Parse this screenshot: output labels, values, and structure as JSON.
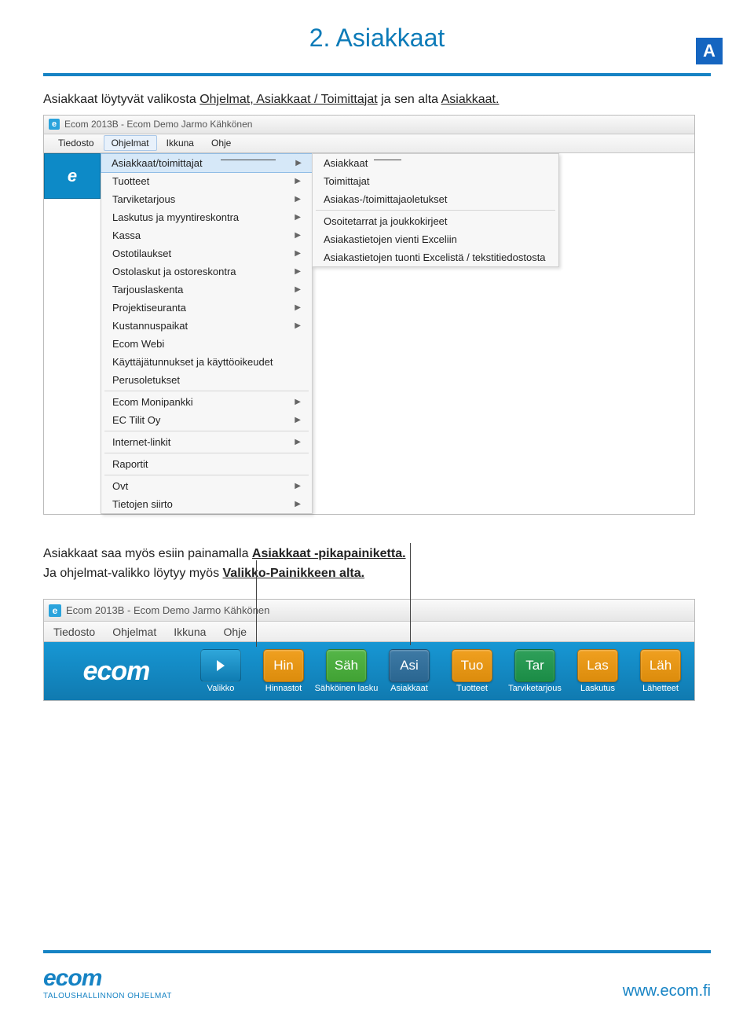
{
  "badge": "A",
  "heading": "2. Asiakkaat",
  "intro_parts": {
    "p1": "Asiakkaat löytyvät valikosta ",
    "u1": "Ohjelmat, Asiakkaat / Toimittajat",
    "p2": " ja sen alta ",
    "u2": "Asiakkaat.",
    "p3": ""
  },
  "shot1": {
    "title": "Ecom 2013B - Ecom Demo Jarmo Kähkönen",
    "menubar": [
      "Tiedosto",
      "Ohjelmat",
      "Ikkuna",
      "Ohje"
    ],
    "ecom_label": "e",
    "col1": [
      {
        "label": "Asiakkaat/toimittajat",
        "arrow": true,
        "hover": true
      },
      {
        "label": "Tuotteet",
        "arrow": true
      },
      {
        "label": "Tarviketarjous",
        "arrow": true
      },
      {
        "label": "Laskutus ja myyntireskontra",
        "arrow": true
      },
      {
        "label": "Kassa",
        "arrow": true
      },
      {
        "label": "Ostotilaukset",
        "arrow": true
      },
      {
        "label": "Ostolaskut ja ostoreskontra",
        "arrow": true
      },
      {
        "label": "Tarjouslaskenta",
        "arrow": true
      },
      {
        "label": "Projektiseuranta",
        "arrow": true
      },
      {
        "label": "Kustannuspaikat",
        "arrow": true
      },
      {
        "label": "Ecom Webi"
      },
      {
        "label": "Käyttäjätunnukset ja käyttöoikeudet"
      },
      {
        "label": "Perusoletukset"
      },
      {
        "sep": true
      },
      {
        "label": "Ecom Monipankki",
        "arrow": true
      },
      {
        "label": "EC Tilit Oy",
        "arrow": true
      },
      {
        "sep": true
      },
      {
        "label": "Internet-linkit",
        "arrow": true
      },
      {
        "sep": true
      },
      {
        "label": "Raportit"
      },
      {
        "sep": true
      },
      {
        "label": "Ovt",
        "arrow": true
      },
      {
        "label": "Tietojen siirto",
        "arrow": true
      }
    ],
    "col2": [
      {
        "label": "Asiakkaat"
      },
      {
        "label": "Toimittajat"
      },
      {
        "label": "Asiakas-/toimittajaoletukset"
      },
      {
        "sep": true
      },
      {
        "label": "Osoitetarrat ja joukkokirjeet"
      },
      {
        "label": "Asiakastietojen vienti Exceliin"
      },
      {
        "label": "Asiakastietojen tuonti Excelistä / tekstitiedostosta"
      }
    ]
  },
  "mid": {
    "line1a": "Asiakkaat saa myös esiin painamalla ",
    "line1b": "Asiakkaat -pikapainiketta.",
    "line2a": "Ja ohjelmat-valikko löytyy myös ",
    "line2b": "Valikko-Painikkeen alta."
  },
  "shot2": {
    "title": "Ecom 2013B - Ecom Demo Jarmo Kähkönen",
    "menubar": [
      "Tiedosto",
      "Ohjelmat",
      "Ikkuna",
      "Ohje"
    ],
    "logo": "ecom",
    "buttons": [
      {
        "code": "valikko",
        "short": "",
        "label": "Valikko",
        "color": "#1a8cc4"
      },
      {
        "code": "hin",
        "short": "Hin",
        "label": "Hinnastot",
        "color": "#f0a020"
      },
      {
        "code": "sah",
        "short": "Säh",
        "label": "Sähköinen lasku",
        "color": "#55b648"
      },
      {
        "code": "asi",
        "short": "Asi",
        "label": "Asiakkaat",
        "color": "#3e7aa5"
      },
      {
        "code": "tuo",
        "short": "Tuo",
        "label": "Tuotteet",
        "color": "#f0a020"
      },
      {
        "code": "tar",
        "short": "Tar",
        "label": "Tarviketarjous",
        "color": "#2fa05a"
      },
      {
        "code": "las",
        "short": "Las",
        "label": "Laskutus",
        "color": "#f0a020"
      },
      {
        "code": "lah",
        "short": "Läh",
        "label": "Lähetteet",
        "color": "#f0a020"
      }
    ]
  },
  "footer": {
    "brand": "ecom",
    "tagline": "TALOUSHALLINNON OHJELMAT",
    "url": "www.ecom.fi"
  }
}
